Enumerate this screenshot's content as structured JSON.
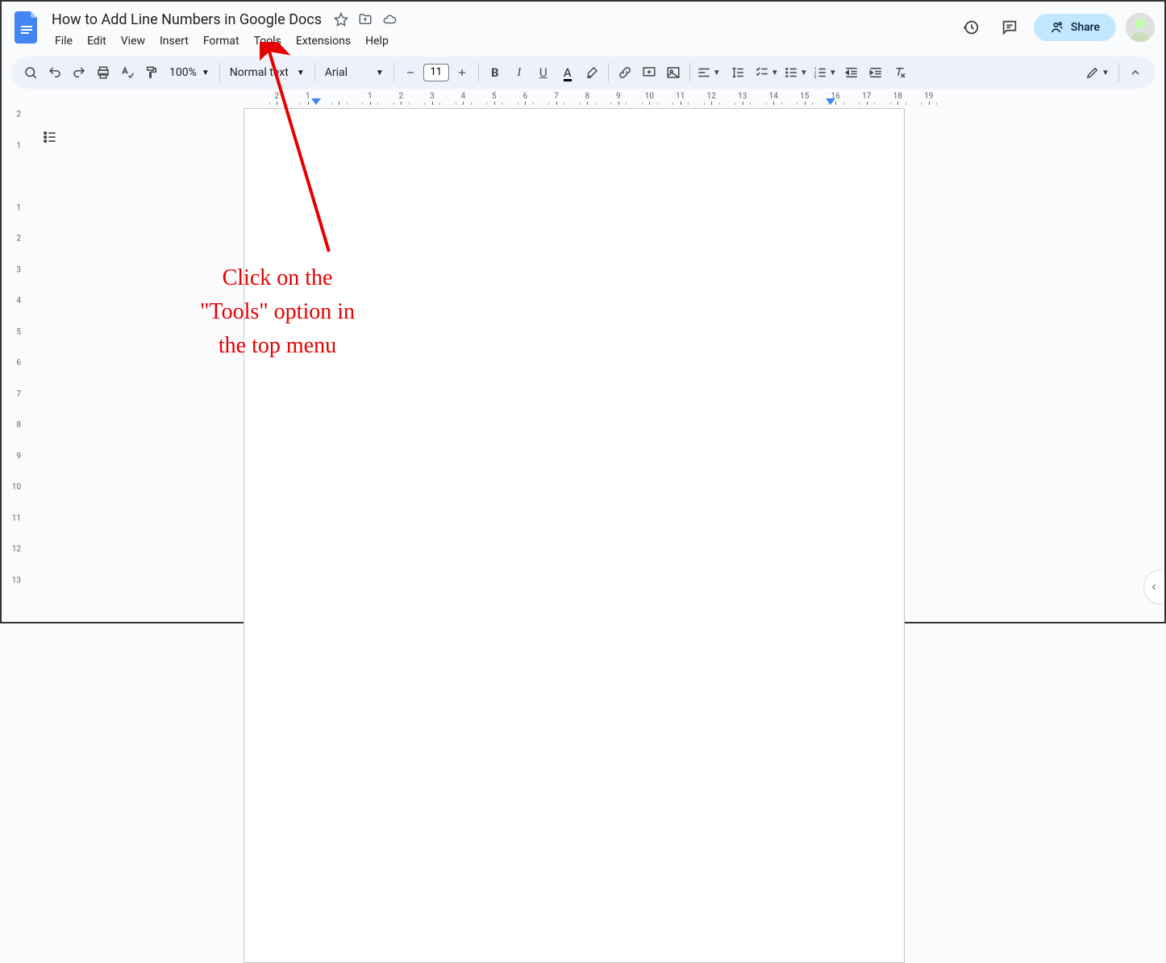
{
  "header": {
    "doc_title": "How to Add Line Numbers in Google Docs",
    "share_label": "Share"
  },
  "menu": {
    "items": [
      "File",
      "Edit",
      "View",
      "Insert",
      "Format",
      "Tools",
      "Extensions",
      "Help"
    ]
  },
  "toolbar": {
    "zoom": "100%",
    "styles": "Normal text",
    "font": "Arial",
    "font_size": "11"
  },
  "ruler": {
    "h_labels": [
      "2",
      "1",
      "",
      "1",
      "2",
      "3",
      "4",
      "5",
      "6",
      "7",
      "8",
      "9",
      "10",
      "11",
      "12",
      "13",
      "14",
      "15",
      "16",
      "17",
      "18",
      "19"
    ],
    "v_labels": [
      "2",
      "1",
      "",
      "1",
      "2",
      "3",
      "4",
      "5",
      "6",
      "7",
      "8",
      "9",
      "10",
      "11",
      "12",
      "13"
    ]
  },
  "annotation": {
    "text": "Click on the\n\"Tools\" option in\nthe top menu"
  }
}
